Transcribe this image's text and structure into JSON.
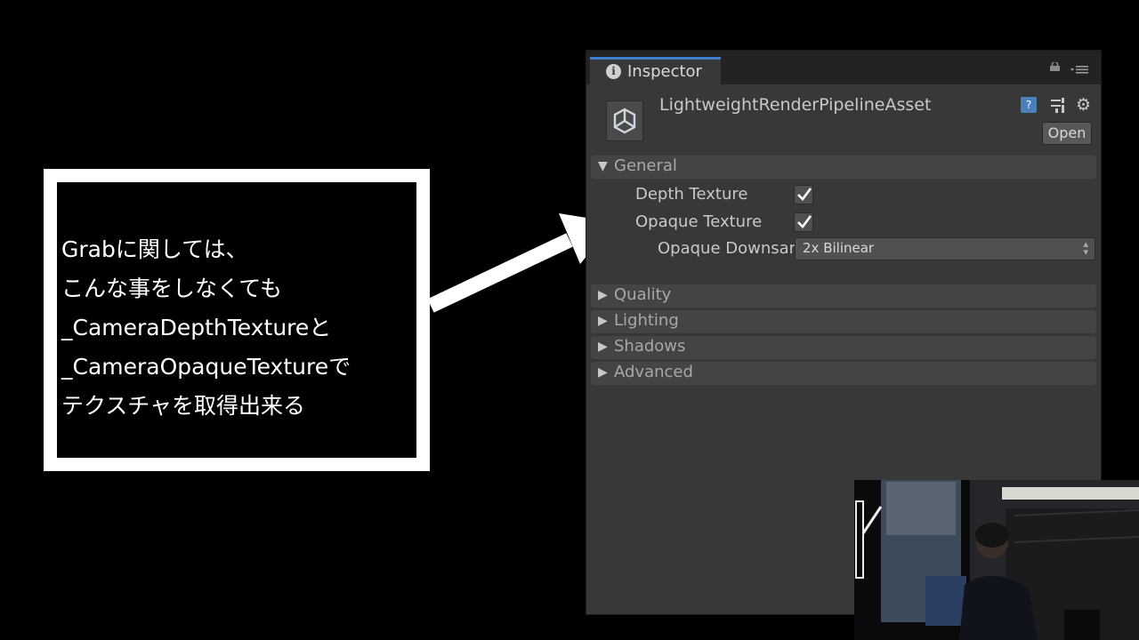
{
  "annotation": {
    "lines": [
      "Grabに関しては、",
      "こんな事をしなくても",
      "_CameraDepthTextureと",
      "_CameraOpaqueTextureで",
      "テクスチャを取得出来る"
    ]
  },
  "inspector": {
    "tab_label": "Inspector",
    "asset_name": "LightweightRenderPipelineAsset",
    "open_button": "Open",
    "help_icon_glyph": "?",
    "sections": {
      "general": "General",
      "quality": "Quality",
      "lighting": "Lighting",
      "shadows": "Shadows",
      "advanced": "Advanced"
    },
    "general": {
      "depth_texture_label": "Depth Texture",
      "depth_texture_checked": true,
      "opaque_texture_label": "Opaque Texture",
      "opaque_texture_checked": true,
      "opaque_downsampling_label": "Opaque Downsampling",
      "opaque_downsampling_value": "2x Bilinear"
    }
  },
  "icons": {
    "tab": "info-icon",
    "lock": "lock-icon",
    "menu": "menu-icon",
    "asset": "unity-logo-icon",
    "help": "help-icon",
    "preset": "preset-icon",
    "gear": "gear-icon",
    "arrow": "arrow-icon"
  },
  "colors": {
    "panel": "#383838",
    "tab_accent": "#3f7fd0",
    "note_border": "#ffffff"
  }
}
